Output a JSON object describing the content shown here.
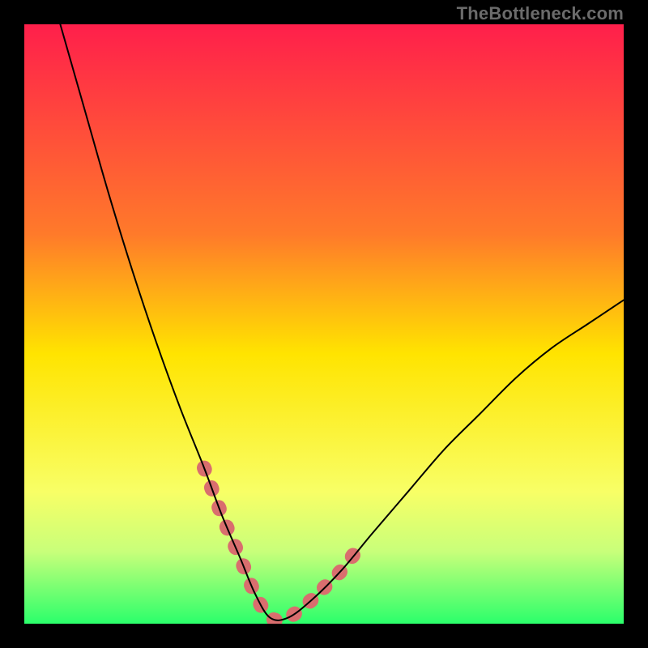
{
  "watermark": "TheBottleneck.com",
  "chart_data": {
    "type": "line",
    "title": "",
    "xlabel": "",
    "ylabel": "",
    "xlim": [
      0,
      100
    ],
    "ylim": [
      0,
      100
    ],
    "grid": false,
    "legend": false,
    "gradient_stops": [
      {
        "offset": 0,
        "color": "#ff1f4b"
      },
      {
        "offset": 35,
        "color": "#ff7a2a"
      },
      {
        "offset": 55,
        "color": "#ffe400"
      },
      {
        "offset": 78,
        "color": "#f8ff66"
      },
      {
        "offset": 88,
        "color": "#c8ff7a"
      },
      {
        "offset": 100,
        "color": "#2bff6b"
      }
    ],
    "series": [
      {
        "name": "bottleneck-curve",
        "x": [
          6,
          10,
          14,
          18,
          22,
          26,
          30,
          33,
          36,
          38.5,
          41,
          44,
          48,
          53,
          58,
          64,
          70,
          76,
          82,
          88,
          94,
          100
        ],
        "y": [
          100,
          86,
          72,
          59,
          47,
          36,
          26,
          18,
          11,
          5,
          1,
          1,
          4,
          9,
          15,
          22,
          29,
          35,
          41,
          46,
          50,
          54
        ]
      }
    ],
    "highlight_segments": [
      {
        "name": "left-highlight",
        "color": "#d96e6e",
        "x": [
          30,
          33,
          36,
          38.5,
          41,
          44,
          48
        ],
        "y": [
          26,
          18,
          11,
          5,
          1,
          1,
          4
        ]
      },
      {
        "name": "right-highlight",
        "color": "#d96e6e",
        "x": [
          50,
          53,
          56
        ],
        "y": [
          6,
          9,
          13
        ]
      }
    ]
  }
}
